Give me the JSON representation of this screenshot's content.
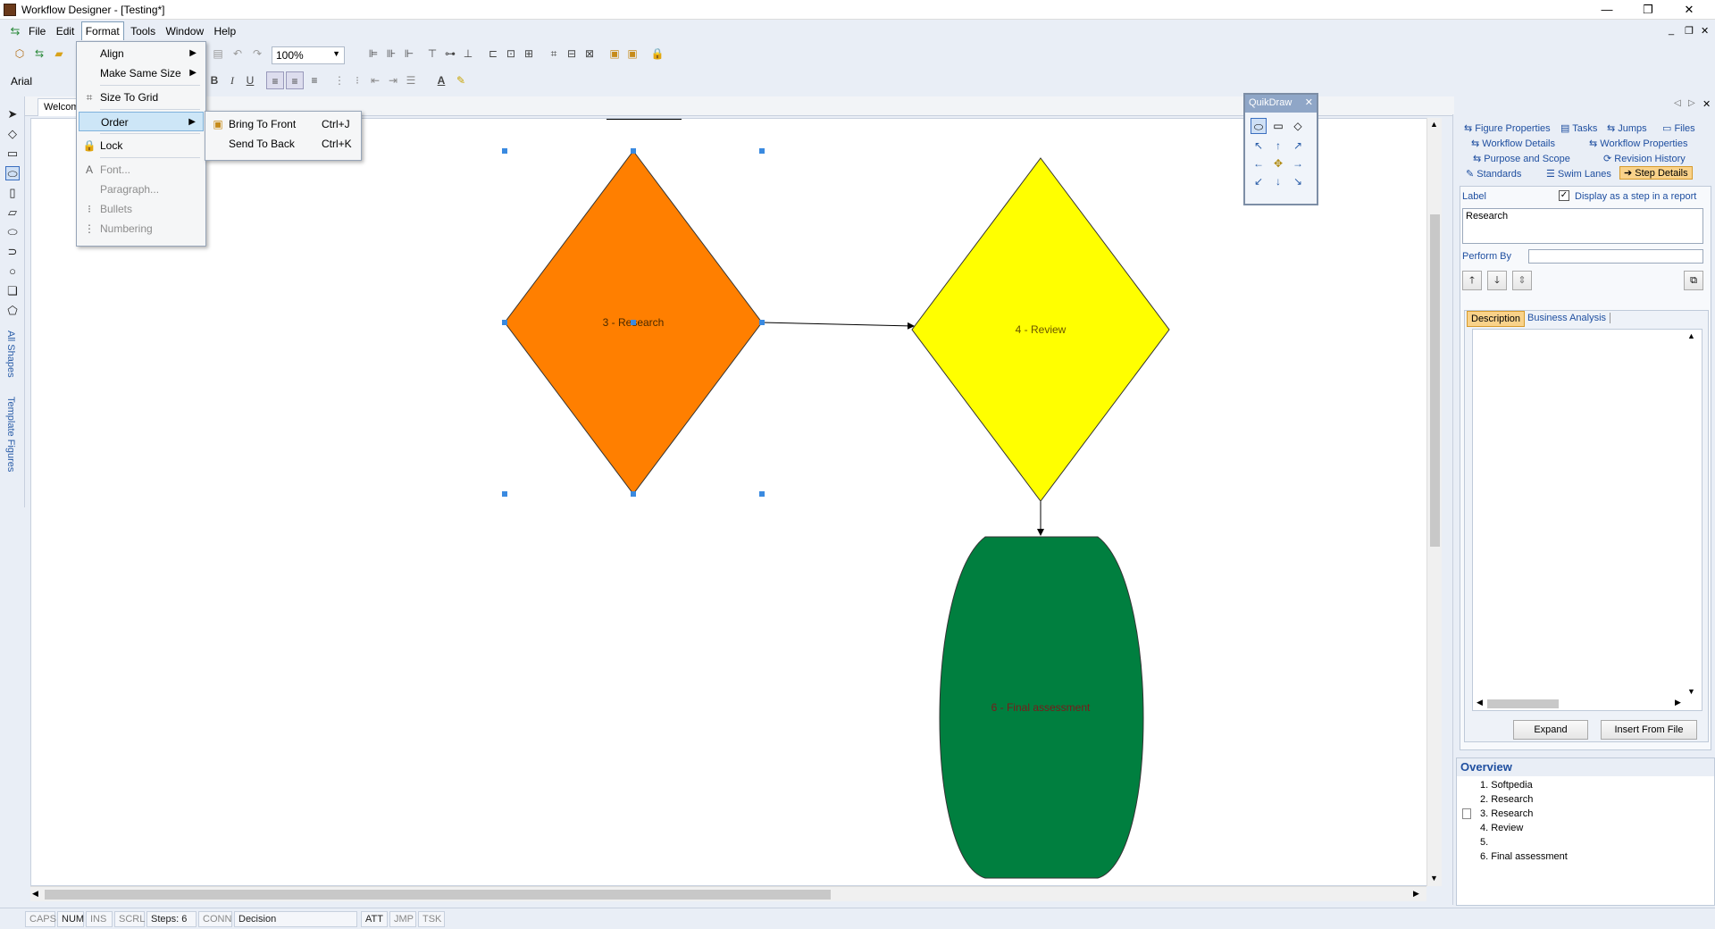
{
  "window": {
    "title": "Workflow Designer - [Testing*]",
    "min": "—",
    "max": "❐",
    "close": "✕"
  },
  "menubar": {
    "file": "File",
    "edit": "Edit",
    "format": "Format",
    "tools": "Tools",
    "window": "Window",
    "help": "Help"
  },
  "toolbar": {
    "zoom": "100%",
    "font": "Arial"
  },
  "format_menu": {
    "align": "Align",
    "make_same_size": "Make Same Size",
    "size_to_grid": "Size To Grid",
    "order": "Order",
    "lock": "Lock",
    "font": "Font...",
    "paragraph": "Paragraph...",
    "bullets": "Bullets",
    "numbering": "Numbering"
  },
  "order_menu": {
    "bring_to_front": "Bring To Front",
    "bring_to_front_key": "Ctrl+J",
    "send_to_back": "Send To Back",
    "send_to_back_key": "Ctrl+K"
  },
  "leftbar": {
    "all_shapes": "All Shapes",
    "template_figures": "Template Figures"
  },
  "document_tab": "Welcome",
  "quikdraw": {
    "title": "QuikDraw"
  },
  "canvas": {
    "shapes": [
      {
        "label": "3 - Research",
        "color": "#ff7f00"
      },
      {
        "label": "4 - Review",
        "color": "#ffff00"
      },
      {
        "label": "6 - Final assessment",
        "color": "#007f3f"
      }
    ]
  },
  "right_panel": {
    "tabs": {
      "figure_properties": "Figure Properties",
      "tasks": "Tasks",
      "jumps": "Jumps",
      "files": "Files",
      "workflow_details": "Workflow Details",
      "workflow_properties": "Workflow Properties",
      "purpose_scope": "Purpose and Scope",
      "revision_history": "Revision History",
      "standards": "Standards",
      "swim_lanes": "Swim Lanes",
      "step_details": "Step Details"
    },
    "label_caption": "Label",
    "display_step": "Display as a step in a report",
    "label_value": "Research",
    "perform_by": "Perform By",
    "perform_by_value": "",
    "subtabs": {
      "description": "Description",
      "business_analysis": "Business Analysis"
    },
    "expand": "Expand",
    "insert_from_file": "Insert From File"
  },
  "overview": {
    "title": "Overview",
    "items": [
      "1. Softpedia",
      "2. Research",
      "3. Research",
      "4. Review",
      "5.",
      "6. Final assessment"
    ]
  },
  "statusbar": {
    "caps": "CAPS",
    "num": "NUM",
    "ins": "INS",
    "scrl": "SCRL",
    "steps": "Steps: 6",
    "conn": "CONN",
    "shape": "Decision",
    "att": "ATT",
    "jmp": "JMP",
    "tsk": "TSK"
  }
}
